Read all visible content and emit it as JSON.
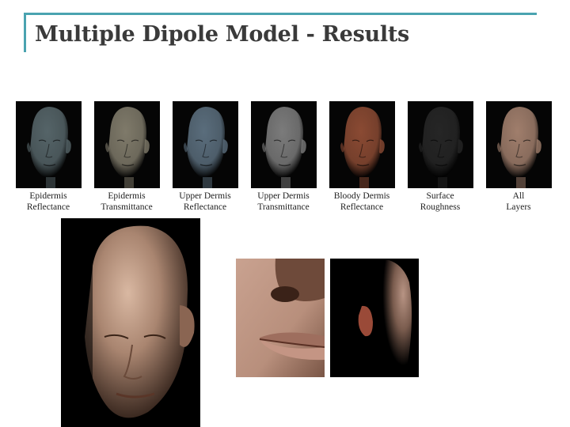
{
  "slide": {
    "title": "Multiple Dipole Model - Results",
    "accent_color": "#4aa3b0"
  },
  "thumbnails": [
    {
      "line1": "Epidermis",
      "line2": "Reflectance",
      "skin": "#556468"
    },
    {
      "line1": "Epidermis",
      "line2": "Transmittance",
      "skin": "#7f7a6a"
    },
    {
      "line1": "Upper Dermis",
      "line2": "Reflectance",
      "skin": "#5a6d7c"
    },
    {
      "line1": "Upper Dermis",
      "line2": "Transmittance",
      "skin": "#7b7b7b"
    },
    {
      "line1": "Bloody Dermis",
      "line2": "Reflectance",
      "skin": "#8a4a33"
    },
    {
      "line1": "Surface",
      "line2": "Roughness",
      "skin": "#262626"
    },
    {
      "line1": "All",
      "line2": "Layers",
      "skin": "#a07e6c"
    }
  ],
  "renders": {
    "large_face_skin": "#a98570",
    "lips_skin": "#b88f7c",
    "side_face_skin": "#7a5c4e"
  }
}
